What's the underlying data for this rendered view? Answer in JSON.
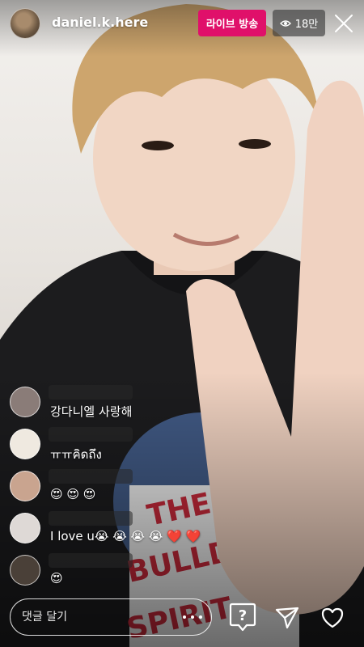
{
  "header": {
    "username": "daniel.k.here",
    "live_label": "라이브 방송",
    "viewer_count": "18만",
    "viewer_icon": "eye-icon",
    "close_icon": "close-icon"
  },
  "comments": [
    {
      "text": "강다니엘 사랑해",
      "avatar_color": "#8a7c78"
    },
    {
      "text": "ㅠㅠคิดถึง",
      "avatar_color": "#efe9e0"
    },
    {
      "text": "😍 😍 😍",
      "avatar_color": "#c9a48f"
    },
    {
      "text": "I love u😭 😭 😭 😭 ❤️ ❤️",
      "avatar_color": "#ded9d6"
    },
    {
      "text": "😍",
      "avatar_color": "#4a4038"
    }
  ],
  "footer": {
    "comment_placeholder": "댓글 달기",
    "more_icon": "more-dots-icon",
    "question_icon": "question-icon",
    "send_icon": "send-icon",
    "like_icon": "heart-icon"
  },
  "colors": {
    "live_badge": "#e0106a",
    "viewer_badge": "rgba(60,60,60,0.65)"
  }
}
